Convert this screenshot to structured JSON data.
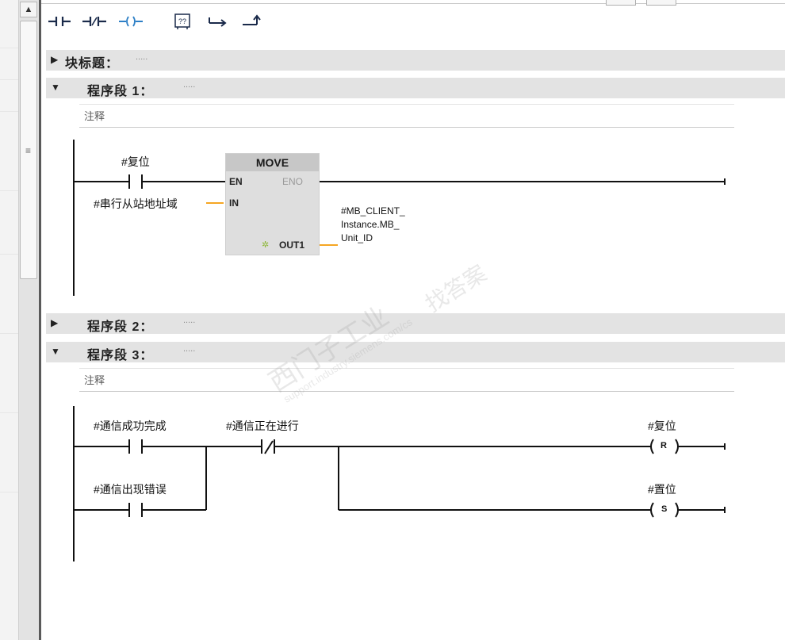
{
  "toolbar": {
    "buttons": [
      {
        "name": "normally-open-contact-icon"
      },
      {
        "name": "normally-closed-contact-icon"
      },
      {
        "name": "output-coil-icon"
      },
      {
        "name": "empty-box-icon",
        "label": "??"
      },
      {
        "name": "open-branch-icon"
      },
      {
        "name": "close-branch-icon"
      }
    ]
  },
  "block_title": {
    "label": "块标题：",
    "comment": "....."
  },
  "networks": [
    {
      "title": "程序段 1：",
      "dots": ".....",
      "comment": "注释",
      "contact_label": "#复位",
      "move_box": {
        "name": "MOVE",
        "en": "EN",
        "eno": "ENO",
        "in": "IN",
        "out": "OUT1"
      },
      "in_operand": "#串行从站地址域",
      "out_operand": [
        "#MB_CLIENT_",
        "Instance.MB_",
        "Unit_ID"
      ]
    },
    {
      "title": "程序段 2：",
      "dots": "....."
    },
    {
      "title": "程序段 3：",
      "dots": ".....",
      "comment": "注释",
      "contact1": "#通信成功完成",
      "contact2": "#通信出现错误",
      "nc_contact": "#通信正在进行",
      "coil_reset_label": "#复位",
      "coil_reset_symbol": "R",
      "coil_set_label": "#置位",
      "coil_set_symbol": "S"
    }
  ],
  "watermark": {
    "line1": "西门子工业",
    "line2": "找答案",
    "line3": "support.industry.siemens.com/cs"
  },
  "colors": {
    "rail": "#111111",
    "operand_wire": "#f5a623",
    "header_bg": "#e3e3e3",
    "box_bg": "#dcdcdc",
    "box_header": "#c4c4c4"
  }
}
